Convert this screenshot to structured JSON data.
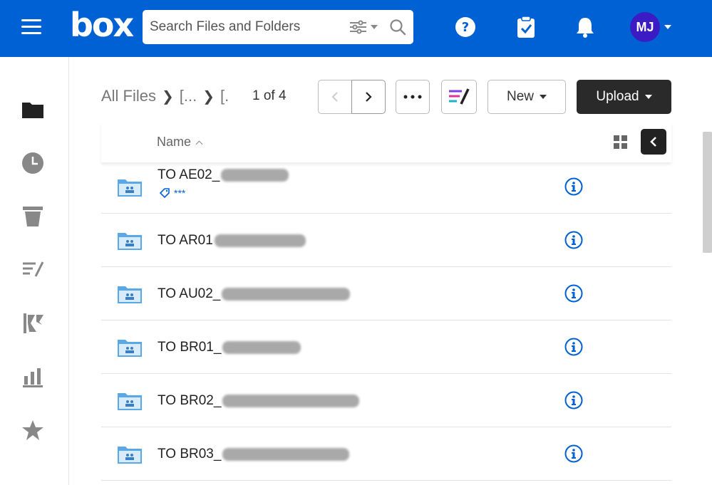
{
  "app": {
    "logo": "box"
  },
  "search": {
    "placeholder": "Search Files and Folders"
  },
  "user": {
    "initials": "MJ"
  },
  "breadcrumb": {
    "root": "All Files",
    "level1": "[...",
    "level2": "[."
  },
  "pager": {
    "text": "1 of 4"
  },
  "toolbar": {
    "new_label": "New",
    "upload_label": "Upload"
  },
  "list": {
    "name_header": "Name",
    "rows": [
      {
        "name": "TO AE02_",
        "tag": "***",
        "redaction_width": 95
      },
      {
        "name": "TO AR01",
        "tag": "",
        "redaction_width": 128
      },
      {
        "name": "TO AU02_",
        "tag": "",
        "redaction_width": 180
      },
      {
        "name": "TO BR01_",
        "tag": "",
        "redaction_width": 110
      },
      {
        "name": "TO BR02_",
        "tag": "",
        "redaction_width": 192
      },
      {
        "name": "TO BR03_",
        "tag": "",
        "redaction_width": 178
      }
    ]
  },
  "colors": {
    "brand": "#0061d5",
    "avatar": "#3b1cc4",
    "folder": "#5aa8e6"
  },
  "icons": {
    "topbar": [
      "menu-icon",
      "help-icon",
      "tasks-icon",
      "notifications-icon"
    ],
    "sidebar": [
      "all-files-icon",
      "recents-icon",
      "trash-icon",
      "notes-icon",
      "relay-icon",
      "insights-icon",
      "favorites-icon"
    ]
  }
}
